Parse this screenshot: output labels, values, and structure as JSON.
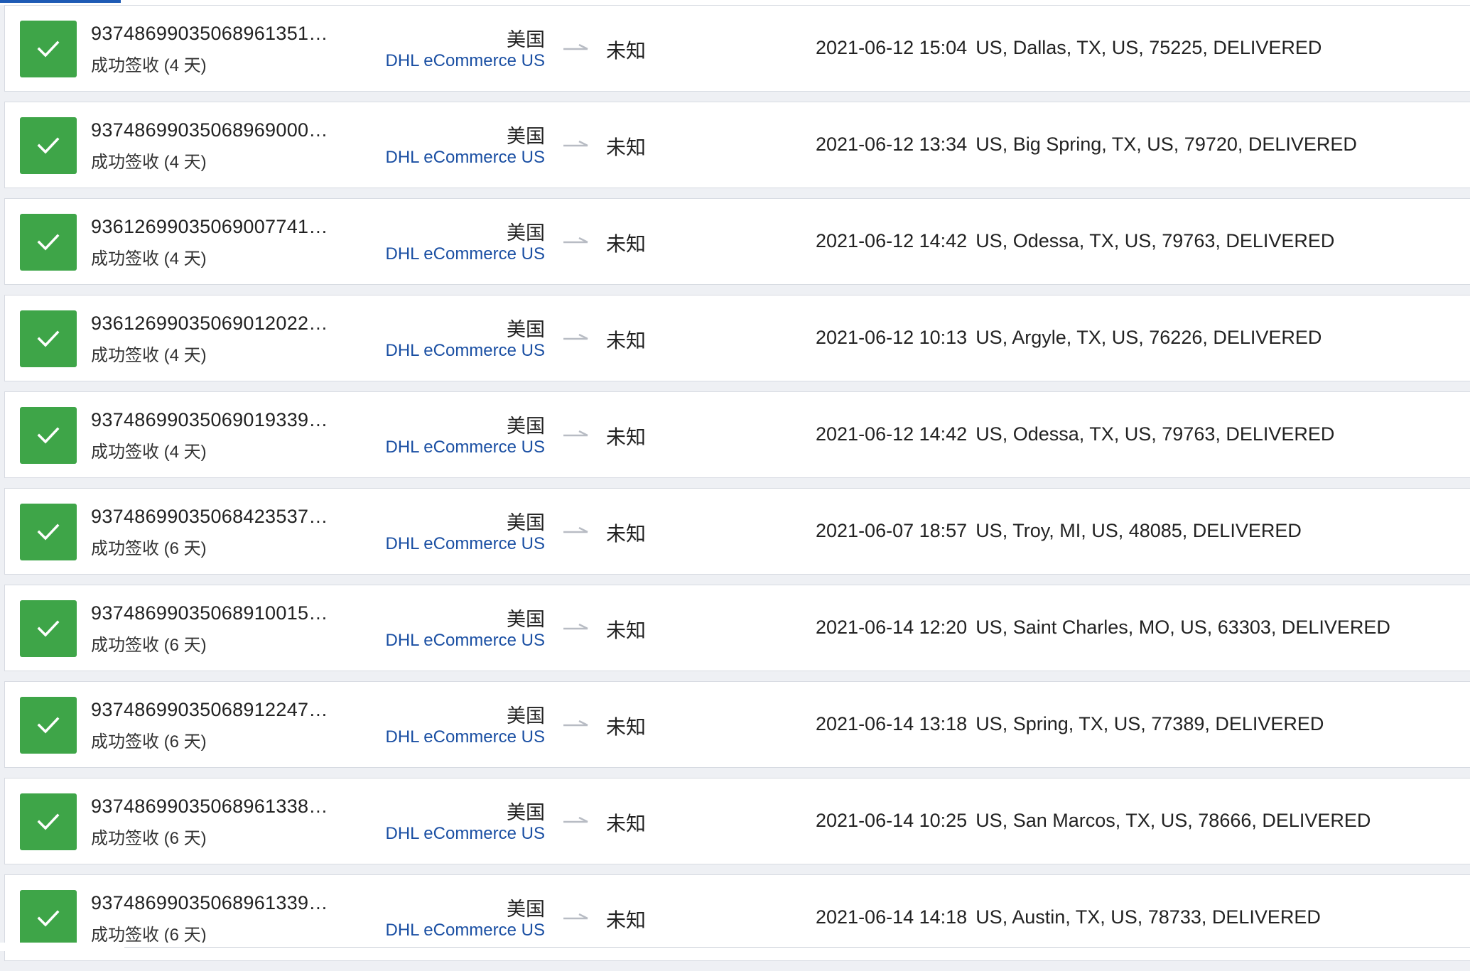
{
  "shipments": [
    {
      "tracking": "93748699035068961351…",
      "status": "成功签收 (4 天)",
      "origin": "美国",
      "carrier": "DHL eCommerce US",
      "destination": "未知",
      "event_time": "2021-06-12 15:04",
      "event_desc": "US, Dallas, TX, US, 75225, DELIVERED"
    },
    {
      "tracking": "93748699035068969000…",
      "status": "成功签收 (4 天)",
      "origin": "美国",
      "carrier": "DHL eCommerce US",
      "destination": "未知",
      "event_time": "2021-06-12 13:34",
      "event_desc": "US, Big Spring, TX, US, 79720, DELIVERED"
    },
    {
      "tracking": "93612699035069007741…",
      "status": "成功签收 (4 天)",
      "origin": "美国",
      "carrier": "DHL eCommerce US",
      "destination": "未知",
      "event_time": "2021-06-12 14:42",
      "event_desc": "US, Odessa, TX, US, 79763, DELIVERED"
    },
    {
      "tracking": "93612699035069012022…",
      "status": "成功签收 (4 天)",
      "origin": "美国",
      "carrier": "DHL eCommerce US",
      "destination": "未知",
      "event_time": "2021-06-12 10:13",
      "event_desc": "US, Argyle, TX, US, 76226, DELIVERED"
    },
    {
      "tracking": "93748699035069019339…",
      "status": "成功签收 (4 天)",
      "origin": "美国",
      "carrier": "DHL eCommerce US",
      "destination": "未知",
      "event_time": "2021-06-12 14:42",
      "event_desc": "US, Odessa, TX, US, 79763, DELIVERED"
    },
    {
      "tracking": "93748699035068423537…",
      "status": "成功签收 (6 天)",
      "origin": "美国",
      "carrier": "DHL eCommerce US",
      "destination": "未知",
      "event_time": "2021-06-07 18:57",
      "event_desc": "US, Troy, MI, US, 48085, DELIVERED"
    },
    {
      "tracking": "93748699035068910015…",
      "status": "成功签收 (6 天)",
      "origin": "美国",
      "carrier": "DHL eCommerce US",
      "destination": "未知",
      "event_time": "2021-06-14 12:20",
      "event_desc": "US, Saint Charles, MO, US, 63303, DELIVERED"
    },
    {
      "tracking": "93748699035068912247…",
      "status": "成功签收 (6 天)",
      "origin": "美国",
      "carrier": "DHL eCommerce US",
      "destination": "未知",
      "event_time": "2021-06-14 13:18",
      "event_desc": "US, Spring, TX, US, 77389, DELIVERED"
    },
    {
      "tracking": "93748699035068961338…",
      "status": "成功签收 (6 天)",
      "origin": "美国",
      "carrier": "DHL eCommerce US",
      "destination": "未知",
      "event_time": "2021-06-14 10:25",
      "event_desc": "US, San Marcos, TX, US, 78666, DELIVERED"
    },
    {
      "tracking": "93748699035068961339…",
      "status": "成功签收 (6 天)",
      "origin": "美国",
      "carrier": "DHL eCommerce US",
      "destination": "未知",
      "event_time": "2021-06-14 14:18",
      "event_desc": "US, Austin, TX, US, 78733, DELIVERED"
    }
  ],
  "icons": {
    "status": "check-icon",
    "route": "arrow-right-icon"
  },
  "colors": {
    "delivered": "#3ea548",
    "carrier_link": "#1a4fa3",
    "accent": "#1e5bb5"
  }
}
